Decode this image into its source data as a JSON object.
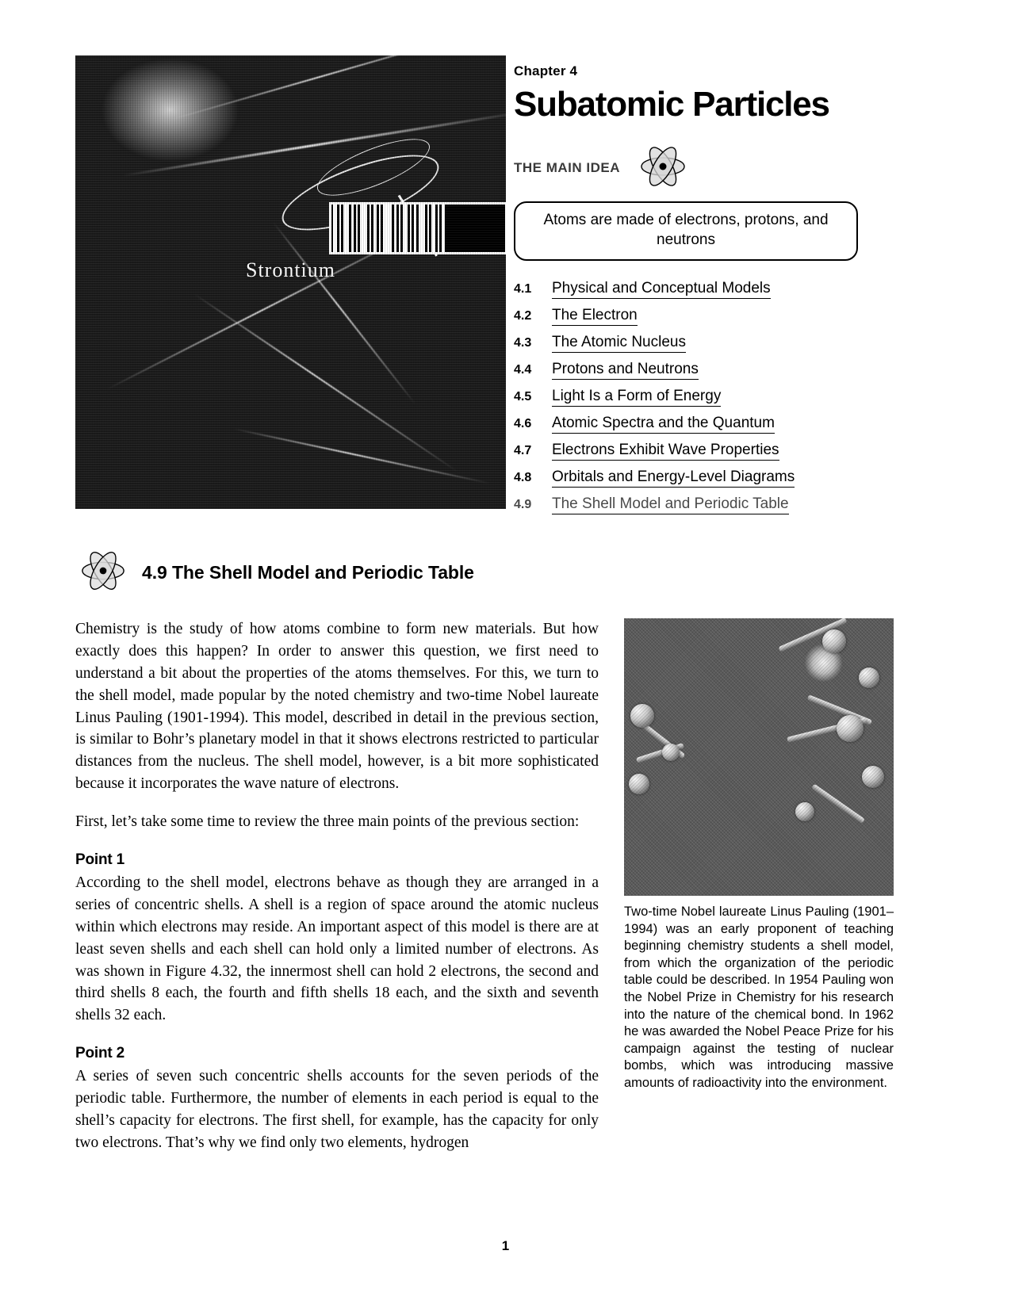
{
  "opener": {
    "chapter_label": "Chapter 4",
    "chapter_title": "Subatomic Particles",
    "main_idea_label": "THE MAIN IDEA",
    "main_idea_text": "Atoms are made of electrons, protons, and neutrons",
    "hero_element_name": "Strontium",
    "atom_icon_name": "atom-icon"
  },
  "toc": [
    {
      "num": "4.1",
      "title": "Physical and Conceptual Models"
    },
    {
      "num": "4.2",
      "title": "The Electron"
    },
    {
      "num": "4.3",
      "title": "The Atomic Nucleus"
    },
    {
      "num": "4.4",
      "title": "Protons and Neutrons"
    },
    {
      "num": "4.5",
      "title": "Light Is a Form of Energy"
    },
    {
      "num": "4.6",
      "title": "Atomic Spectra and the Quantum"
    },
    {
      "num": "4.7",
      "title": "Electrons Exhibit Wave Properties"
    },
    {
      "num": "4.8",
      "title": "Orbitals and Energy-Level Diagrams"
    },
    {
      "num": "4.9",
      "title": "The Shell Model and Periodic Table"
    }
  ],
  "section": {
    "heading": "4.9  The Shell Model and Periodic Table",
    "paragraph_1": "Chemistry is the study of how atoms combine to form new materials. But how exactly does this happen? In order to answer this question, we first need to understand a bit about the properties of the atoms themselves. For this, we turn to the shell model, made popular by the noted chemistry and two-time Nobel laureate Linus Pauling (1901-1994). This model, described in detail in the previous section, is similar to Bohr’s planetary model in that it shows electrons restricted to particular distances from the nucleus. The shell model, however, is a bit more sophisticated because it incorporates the wave nature of electrons.",
    "paragraph_2": "First, let’s take some time to review the three main points of the previous section:",
    "point_1_label": "Point 1",
    "point_1_text": "According to the shell model, electrons behave as though they are arranged in a series of concentric shells. A shell is a region of space around the atomic nucleus within which electrons may reside. An important aspect of this model is there are at least seven shells and each shell can hold only a limited number of electrons. As was shown in Figure 4.32, the innermost shell can hold 2 electrons, the second and third shells 8 each, the fourth and fifth shells 18 each, and the sixth and seventh shells 32 each.",
    "point_2_label": "Point 2",
    "point_2_text": "A series of seven such concentric shells accounts for the seven periods of the periodic table. Furthermore, the number of elements in each period is equal to the shell’s capacity for electrons. The first shell, for example, has the capacity for only two electrons. That’s why we find only two elements, hydrogen"
  },
  "figure": {
    "caption": "Two-time Nobel laureate Linus Pauling (1901–1994) was an early proponent of teaching beginning chemistry students a shell model, from which the organization of the periodic table could be described. In 1954 Pauling won the Nobel Prize in Chemistry for his research into the nature of the chemical bond. In 1962 he was awarded the Nobel Peace Prize for his campaign against the testing of nuclear bombs, which was introducing massive amounts of radioactivity into the environment.",
    "photo_name": "linus-pauling-photo"
  },
  "footer": {
    "page_number": "1"
  },
  "colors": {
    "text": "#000000",
    "background": "#ffffff",
    "photo_dark": "#101010"
  }
}
